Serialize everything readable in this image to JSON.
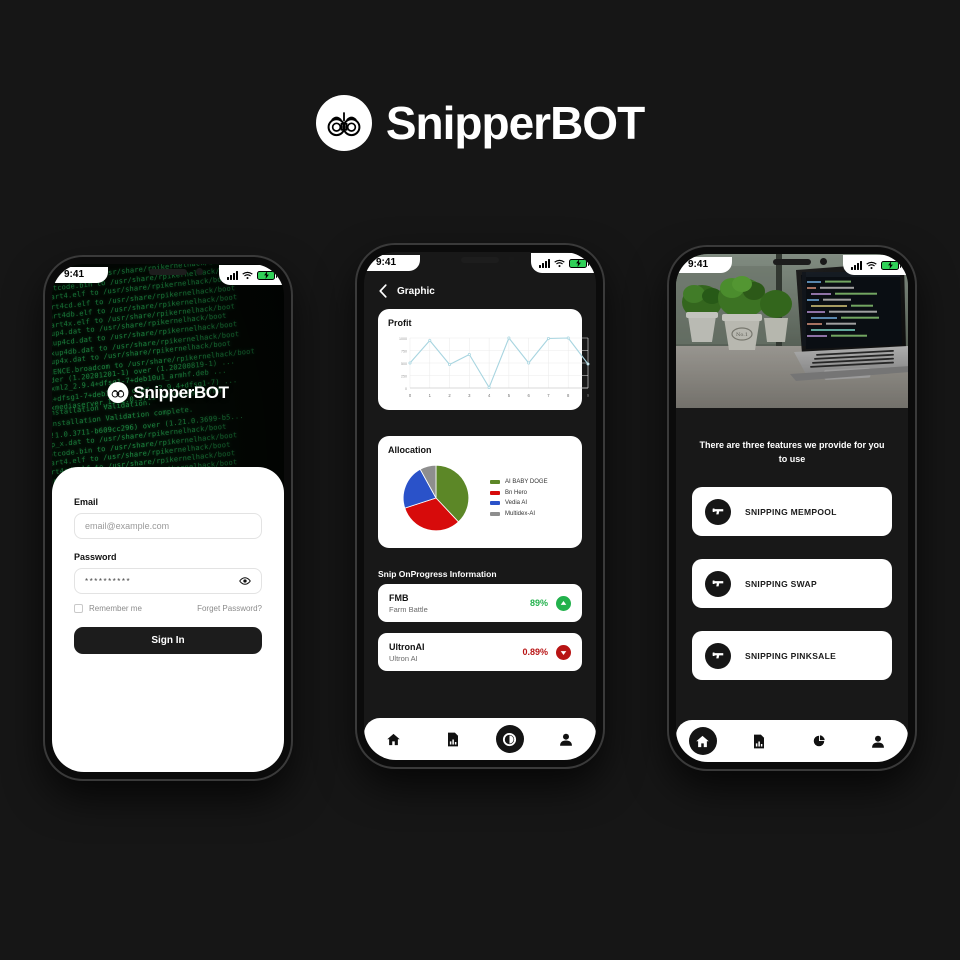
{
  "brand": {
    "name": "SnipperBOT",
    "mark_icon": "binoculars-icon"
  },
  "theme": {
    "page_bg": "#161616",
    "accent_green": "#22b14c",
    "accent_red": "#b81414",
    "dark": "#1c1c1c"
  },
  "statusbar": {
    "time": "9:41",
    "signal_icon": "cellular-bars-icon",
    "wifi_icon": "wifi-icon",
    "battery_icon": "battery-charging-icon"
  },
  "phone_login": {
    "logo_name": "SnipperBOT",
    "terminal_lines": [
      "up_x.dat to /usr/share/rpikernelhack/boot",
      "otcode.bin to /usr/share/rpikernelhack/boot",
      "art4.elf to /usr/share/rpikernelhack/boot",
      "art4cd.elf to /usr/share/rpikernelhack/boot",
      "art4db.elf to /usr/share/rpikernelhack/boot",
      "art4x.elf to /usr/share/rpikernelhack/boot",
      "xup4.dat to /usr/share/rpikernelhack/boot",
      "xup4cd.dat to /usr/share/rpikernelhack/boot",
      "xup4db.dat to /usr/share/rpikernelhack/boot",
      "xup4x.dat to /usr/share/rpikernelhack/boot",
      "CENCE.broadcom to /usr/share/rpikernelhack/boot",
      "der (1.20201201-1) over (1.20200819-1) ...",
      "bxml2_2.9.4+dfsg1-7+deb10u1_armhf.deb ...",
      "1+dfsg1-7+deb10u1) over (2.9.4+dfsg1-7) ...",
      "xmediaserver_1.21.0.3711-b609cc296_armhf",
      "installation Validation.",
      "installation Validation complete.",
      "!1.0.3711-b609cc296) over (1.21.0.3699-b5..."
    ],
    "form": {
      "email_label": "Email",
      "email_placeholder": "email@example.com",
      "password_label": "Password",
      "password_value": "**********",
      "eye_icon": "eye-icon",
      "remember_label": "Remember me",
      "forgot_label": "Forget Password?",
      "submit_label": "Sign In"
    }
  },
  "phone_graphic": {
    "back_icon": "chevron-left-icon",
    "title": "Graphic",
    "section_title": "Snip OnProgress Information",
    "progress_items": [
      {
        "name": "FMB",
        "subtitle": "Farm Battle",
        "percent": "89%",
        "direction": "up",
        "color": "#22b14c",
        "arrow_icon": "arrow-up-icon"
      },
      {
        "name": "UltronAI",
        "subtitle": "Ultron AI",
        "percent": "0.89%",
        "direction": "down",
        "color": "#b81414",
        "arrow_icon": "arrow-down-icon"
      }
    ],
    "nav": [
      {
        "label": "home",
        "icon": "home-icon",
        "active": false
      },
      {
        "label": "report",
        "icon": "document-chart-icon",
        "active": false
      },
      {
        "label": "graphic",
        "icon": "pie-chart-icon",
        "active": true
      },
      {
        "label": "profile",
        "icon": "person-icon",
        "active": false
      }
    ]
  },
  "phone_features": {
    "hero_image_alt": "laptop-with-code-and-plants-photo",
    "headline": "There are three features we provide for you to use",
    "features": [
      {
        "label": "SNIPPING MEMPOOL",
        "icon": "gun-icon"
      },
      {
        "label": "SNIPPING SWAP",
        "icon": "gun-icon"
      },
      {
        "label": "SNIPPING PINKSALE",
        "icon": "gun-icon"
      }
    ],
    "nav": [
      {
        "label": "home",
        "icon": "home-icon",
        "active": true
      },
      {
        "label": "report",
        "icon": "document-chart-icon",
        "active": false
      },
      {
        "label": "graphic",
        "icon": "pie-chart-icon",
        "active": false
      },
      {
        "label": "profile",
        "icon": "person-icon",
        "active": false
      }
    ]
  },
  "chart_data": [
    {
      "type": "line",
      "title": "Profit",
      "x": [
        0,
        1,
        2,
        3,
        4,
        5,
        6,
        7,
        8,
        9
      ],
      "values": [
        500,
        950,
        470,
        670,
        10,
        1000,
        500,
        990,
        1000,
        480
      ],
      "xlabel": "",
      "ylabel": "",
      "ylim": [
        0,
        1000
      ],
      "yticks": [
        0,
        250,
        500,
        750,
        1000
      ],
      "xticks": [
        0,
        1,
        2,
        3,
        4,
        5,
        6,
        7,
        8,
        9
      ],
      "grid": true,
      "line_color": "#a8d5e0",
      "legend": false
    },
    {
      "type": "pie",
      "title": "Allocation",
      "categories": [
        "AI BABY DOGE",
        "Bn Hero",
        "Vedia AI",
        "Multidex-AI"
      ],
      "values": [
        38,
        32,
        22,
        8
      ],
      "colors": [
        "#5c8727",
        "#d70b0b",
        "#2a52c9",
        "#8e8e8e"
      ],
      "legend": true,
      "legend_position": "right"
    }
  ]
}
